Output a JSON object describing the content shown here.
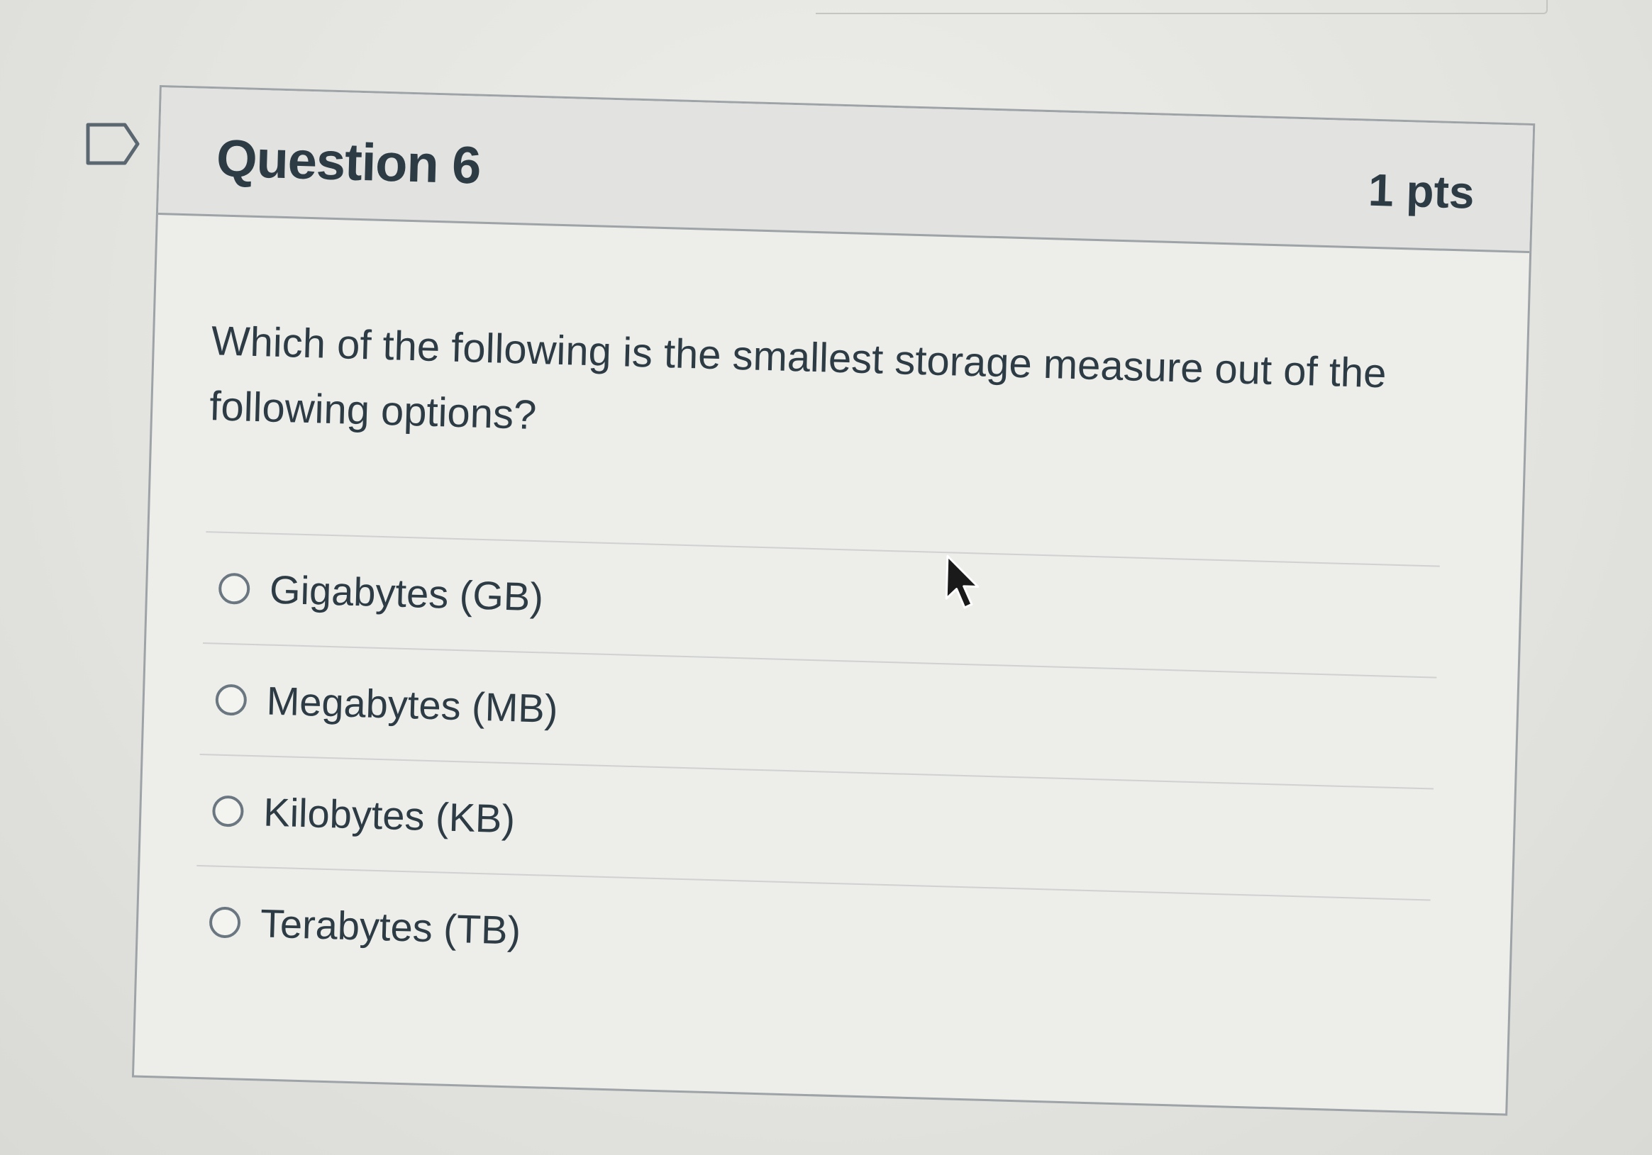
{
  "question": {
    "title": "Question 6",
    "points": "1 pts",
    "text": "Which of the following is the smallest storage measure out of the following options?",
    "answers": [
      {
        "label": "Gigabytes (GB)"
      },
      {
        "label": "Megabytes (MB)"
      },
      {
        "label": "Kilobytes (KB)"
      },
      {
        "label": "Terabytes (TB)"
      }
    ]
  },
  "icons": {
    "flag": "bookmark-flag-icon",
    "cursor": "mouse-pointer-icon"
  },
  "colors": {
    "text": "#2d3b45",
    "border": "#9da3a6",
    "header_bg": "#e2e3e0",
    "page_bg": "#e4e4e0"
  }
}
